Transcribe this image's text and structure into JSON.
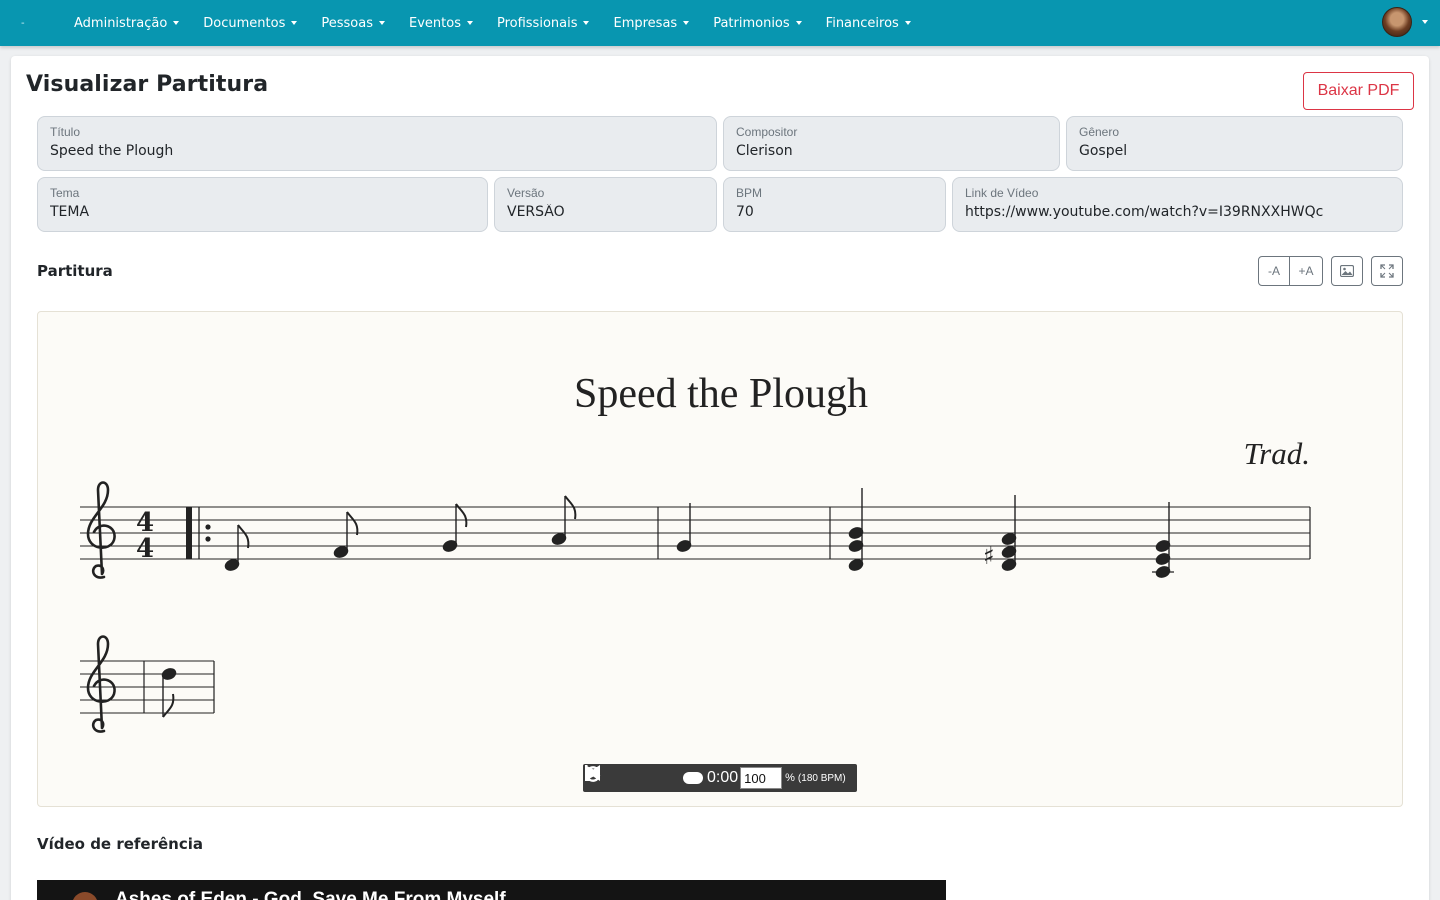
{
  "navbar": {
    "brand": "-",
    "menu": [
      {
        "label": "Administração"
      },
      {
        "label": "Documentos"
      },
      {
        "label": "Pessoas"
      },
      {
        "label": "Eventos"
      },
      {
        "label": "Profissionais"
      },
      {
        "label": "Empresas"
      },
      {
        "label": "Patrimonios"
      },
      {
        "label": "Financeiros"
      }
    ]
  },
  "page": {
    "title": "Visualizar Partitura",
    "pdf_button": "Baixar PDF"
  },
  "fields": {
    "titulo": {
      "label": "Título",
      "value": "Speed the Plough"
    },
    "compositor": {
      "label": "Compositor",
      "value": "Clerison"
    },
    "genero": {
      "label": "Gênero",
      "value": "Gospel"
    },
    "tema": {
      "label": "Tema",
      "value": "TEMA"
    },
    "versao": {
      "label": "Versão",
      "value": "VERSÂO"
    },
    "bpm": {
      "label": "BPM",
      "value": "70"
    },
    "video_link": {
      "label": "Link de Vídeo",
      "value": "https://www.youtube.com/watch?v=I39RNXXHWQc"
    }
  },
  "score_section": {
    "title": "Partitura",
    "font_smaller": "-A",
    "font_larger": "+A",
    "image_icon": "image-icon",
    "fullscreen_icon": "fullscreen-icon"
  },
  "score": {
    "title": "Speed the Plough",
    "composer": "Trad.",
    "time_signature": "4/4",
    "clef": "treble"
  },
  "player": {
    "time": "0:00",
    "tempo_percent": "100",
    "percent_sign": "%",
    "bpm_text": "(180 BPM)"
  },
  "video_section": {
    "title": "Vídeo de referência",
    "video_title": "Ashes of Eden - God, Save Me From Myself"
  }
}
